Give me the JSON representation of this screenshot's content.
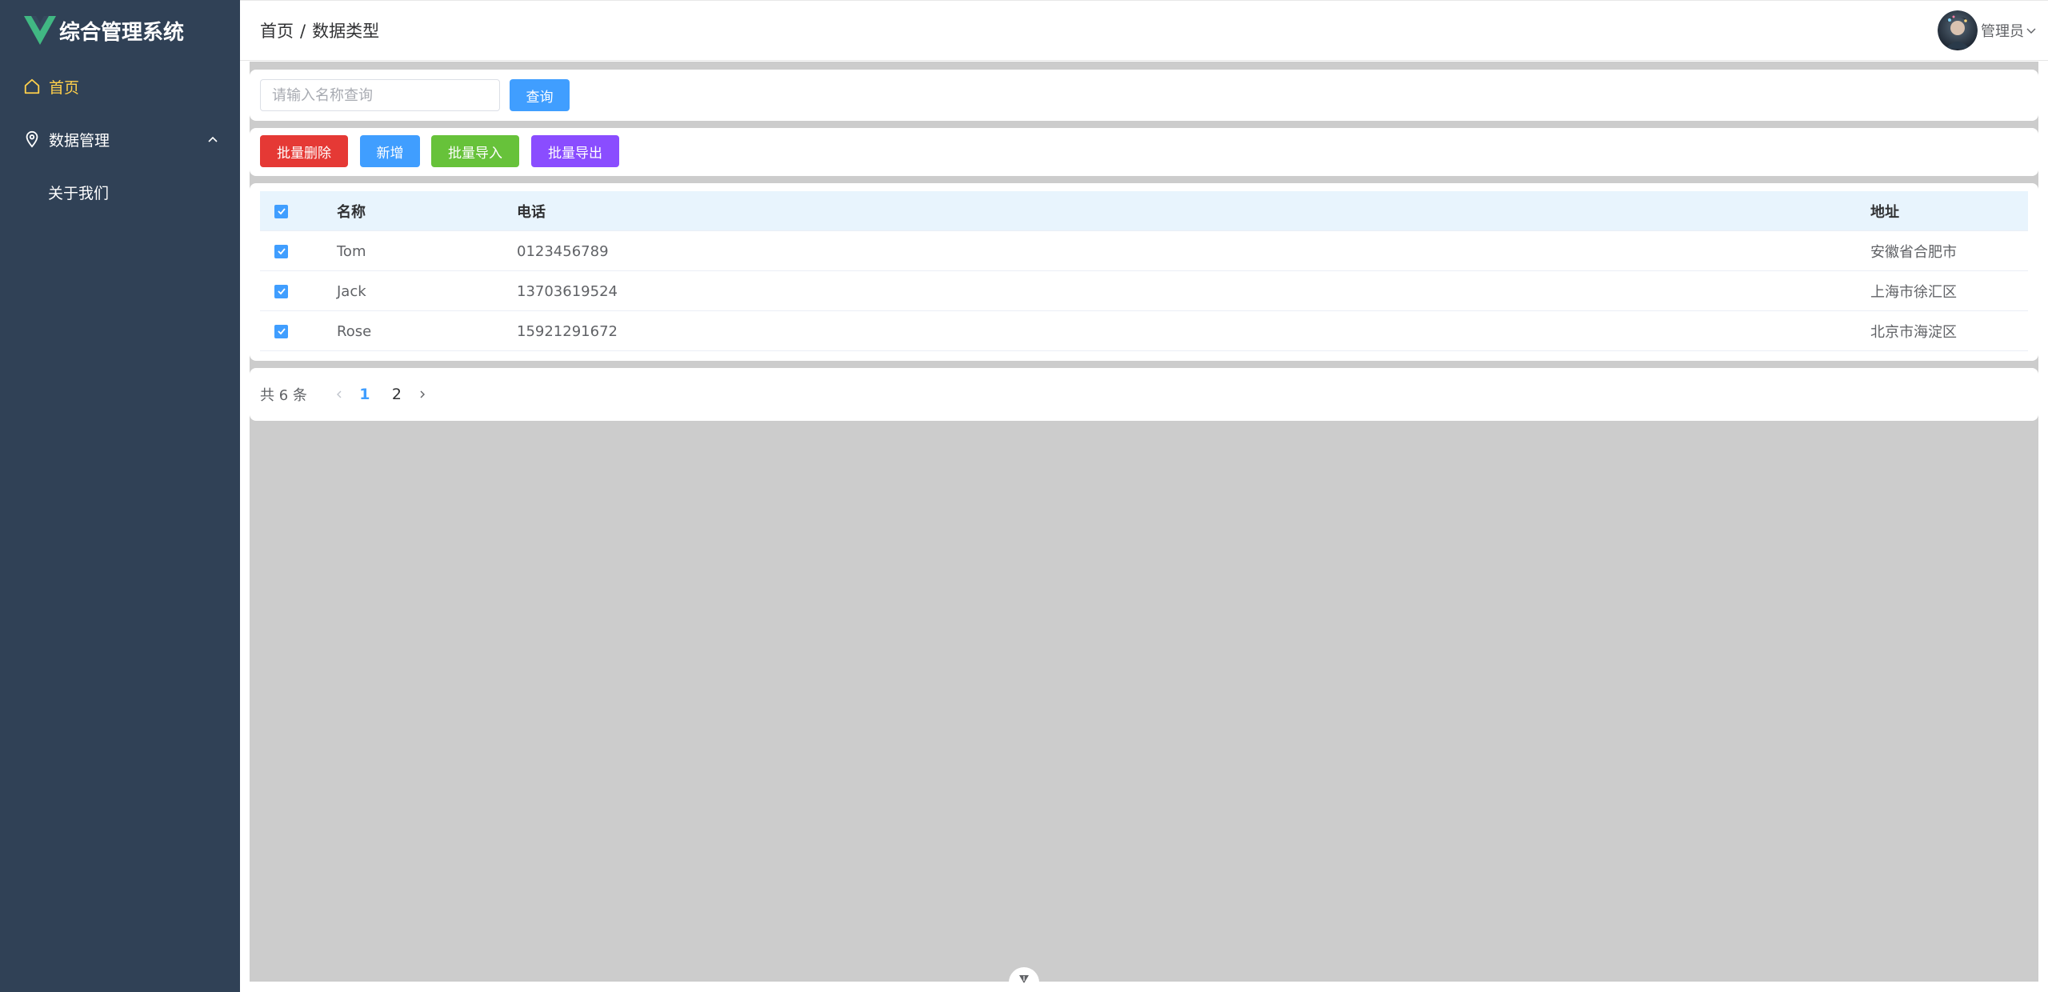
{
  "app": {
    "title": "综合管理系统",
    "colors": {
      "sidebar_bg": "#304156",
      "active_menu": "#ffd04b",
      "primary": "#409eff",
      "danger": "#e53935",
      "success": "#67c23a",
      "purple": "#8a4dff",
      "table_header_bg": "#e8f4fd",
      "content_bg": "#cccccc"
    }
  },
  "sidebar": {
    "logo_icon": "vue-logo-icon",
    "items": [
      {
        "label": "首页",
        "icon": "home-icon",
        "active": true
      },
      {
        "label": "数据管理",
        "icon": "location-icon",
        "expanded": true,
        "children": [
          {
            "label": "关于我们"
          }
        ]
      }
    ]
  },
  "header": {
    "breadcrumb": [
      "首页",
      "数据类型"
    ],
    "breadcrumb_separator": "/",
    "user": {
      "name": "管理员",
      "icon": "chevron-down-icon"
    }
  },
  "search": {
    "placeholder": "请输入名称查询",
    "value": "",
    "button_label": "查询"
  },
  "toolbar": {
    "batch_delete": "批量删除",
    "add": "新增",
    "batch_import": "批量导入",
    "batch_export": "批量导出"
  },
  "table": {
    "columns": [
      "名称",
      "电话",
      "地址"
    ],
    "header_checked": true,
    "rows": [
      {
        "checked": true,
        "name": "Tom",
        "phone": "0123456789",
        "address": "安徽省合肥市"
      },
      {
        "checked": true,
        "name": "Jack",
        "phone": "13703619524",
        "address": "上海市徐汇区"
      },
      {
        "checked": true,
        "name": "Rose",
        "phone": "15921291672",
        "address": "北京市海淀区"
      }
    ]
  },
  "pagination": {
    "total_text": "共 6 条",
    "pages": [
      "1",
      "2"
    ],
    "current_page": 1
  }
}
